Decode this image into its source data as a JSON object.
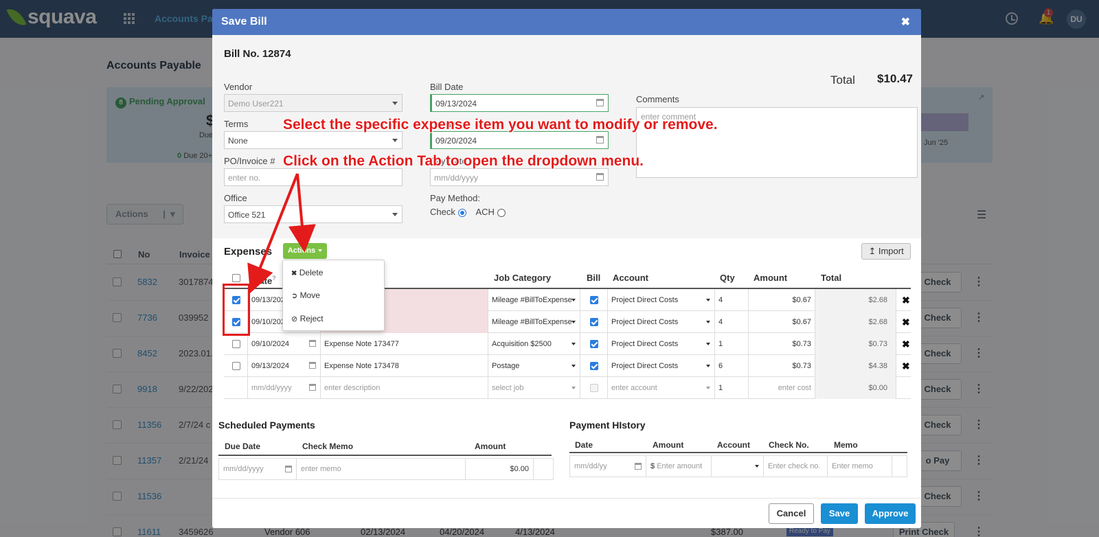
{
  "app": {
    "logo": "squava",
    "nav": "Accounts Pay",
    "user_initials": "DU",
    "notifications": "1"
  },
  "background": {
    "page_title": "Accounts Payable",
    "pending_label": "Pending Approval",
    "pending_icon_num": "8",
    "pending_sub": "Due",
    "pending_amount": "$",
    "due_20_count": "0",
    "due_20_label": "Due 20+",
    "chart_month": "Jun '25",
    "actions_label": "Actions",
    "headers": {
      "no": "No",
      "invoice": "Invoice"
    },
    "rows": [
      {
        "no": "5832",
        "invoice": "3017874",
        "btn": "Check"
      },
      {
        "no": "7736",
        "invoice": "039952",
        "btn": "Check"
      },
      {
        "no": "8452",
        "invoice": "2023.01.",
        "btn": "Check"
      },
      {
        "no": "9918",
        "invoice": "9/22/202",
        "btn": "Check"
      },
      {
        "no": "11356",
        "invoice": "2/7/24 c",
        "btn": "Check"
      },
      {
        "no": "11357",
        "invoice": "2/21/24",
        "btn": "o Pay"
      },
      {
        "no": "11536",
        "invoice": "",
        "btn": "Check"
      },
      {
        "no": "11611",
        "invoice": "3459626",
        "btn": "Print Check"
      }
    ],
    "last_row": {
      "vendor": "Vendor 606",
      "date1": "02/13/2024",
      "date2": "04/20/2024",
      "date3": "4/13/2024",
      "amount": "$387.00",
      "status": "Ready to Pay"
    }
  },
  "modal": {
    "title": "Save Bill",
    "bill_no": "Bill No. 12874",
    "vendor": {
      "label": "Vendor",
      "value": "Demo User221"
    },
    "terms": {
      "label": "Terms",
      "value": "None"
    },
    "po": {
      "label": "PO/Invoice #",
      "placeholder": "enter no."
    },
    "office": {
      "label": "Office",
      "value": "Office 521"
    },
    "bill_date": {
      "label": "Bill Date",
      "value": "09/13/2024"
    },
    "due_date": {
      "label": "Due Date",
      "value": "09/20/2024"
    },
    "pay_date": {
      "label": "Pay Date",
      "placeholder": "mm/dd/yyyy"
    },
    "pay_method": {
      "label": "Pay Method:",
      "check": "Check",
      "ach": "ACH",
      "selected": "Check"
    },
    "total": {
      "label": "Total",
      "value": "$10.47"
    },
    "comments": {
      "label": "Comments",
      "placeholder": "enter comment"
    },
    "expenses_title": "Expenses",
    "actions_btn": "Actions",
    "import_btn": "Import",
    "columns": {
      "date": "Date",
      "date_help": "?",
      "job": "Job Category",
      "bill": "Bill",
      "account": "Account",
      "qty": "Qty",
      "amount": "Amount",
      "total": "Total"
    },
    "expenses": [
      {
        "checked": true,
        "date": "09/13/202",
        "desc": "",
        "job": "Mileage #BillToExpense",
        "bill": true,
        "account": "Project Direct Costs",
        "qty": "4",
        "amount": "$0.67",
        "total": "$2.68"
      },
      {
        "checked": true,
        "date": "09/10/202",
        "desc": "",
        "job": "Mileage #BillToExpense",
        "bill": true,
        "account": "Project Direct Costs",
        "qty": "4",
        "amount": "$0.67",
        "total": "$2.68"
      },
      {
        "checked": false,
        "date": "09/10/2024",
        "desc": "Expense Note 173477",
        "job": "Acquisition $2500",
        "bill": true,
        "account": "Project Direct Costs",
        "qty": "1",
        "amount": "$0.73",
        "total": "$0.73"
      },
      {
        "checked": false,
        "date": "09/13/2024",
        "desc": "Expense Note 173478",
        "job": "Postage",
        "bill": true,
        "account": "Project Direct Costs",
        "qty": "6",
        "amount": "$0.73",
        "total": "$4.38"
      }
    ],
    "new_row": {
      "date": "mm/dd/yyyy",
      "desc": "enter description",
      "job": "select job",
      "account": "enter account",
      "qty": "1",
      "amount": "enter cost",
      "total": "$0.00"
    },
    "menu": {
      "delete": "Delete",
      "move": "Move",
      "reject": "Reject"
    },
    "scheduled": {
      "title": "Scheduled Payments",
      "due_date": "Due Date",
      "memo": "Check Memo",
      "amount": "Amount",
      "date_ph": "mm/dd/yyyy",
      "memo_ph": "enter memo",
      "amount_val": "$0.00"
    },
    "history": {
      "title": "Payment HIstory",
      "date": "Date",
      "amount": "Amount",
      "account": "Account",
      "check_no": "Check No.",
      "memo": "Memo",
      "date_ph": "mm/dd/yy",
      "currency": "$",
      "amount_ph": "Enter amount",
      "check_ph": "Enter check no.",
      "memo_ph": "Enter memo"
    },
    "buttons": {
      "cancel": "Cancel",
      "save": "Save",
      "approve": "Approve"
    }
  },
  "callouts": {
    "line1": "Select the specific expense item you want to modify or remove.",
    "line2": "Click on the Action Tab to open the dropdown menu."
  },
  "colors": {
    "header": "#3f5a7a",
    "modal_header": "#5077c1",
    "accent_green": "#7cc142",
    "primary": "#1a8fd4",
    "annotation_red": "#e31b1b"
  }
}
